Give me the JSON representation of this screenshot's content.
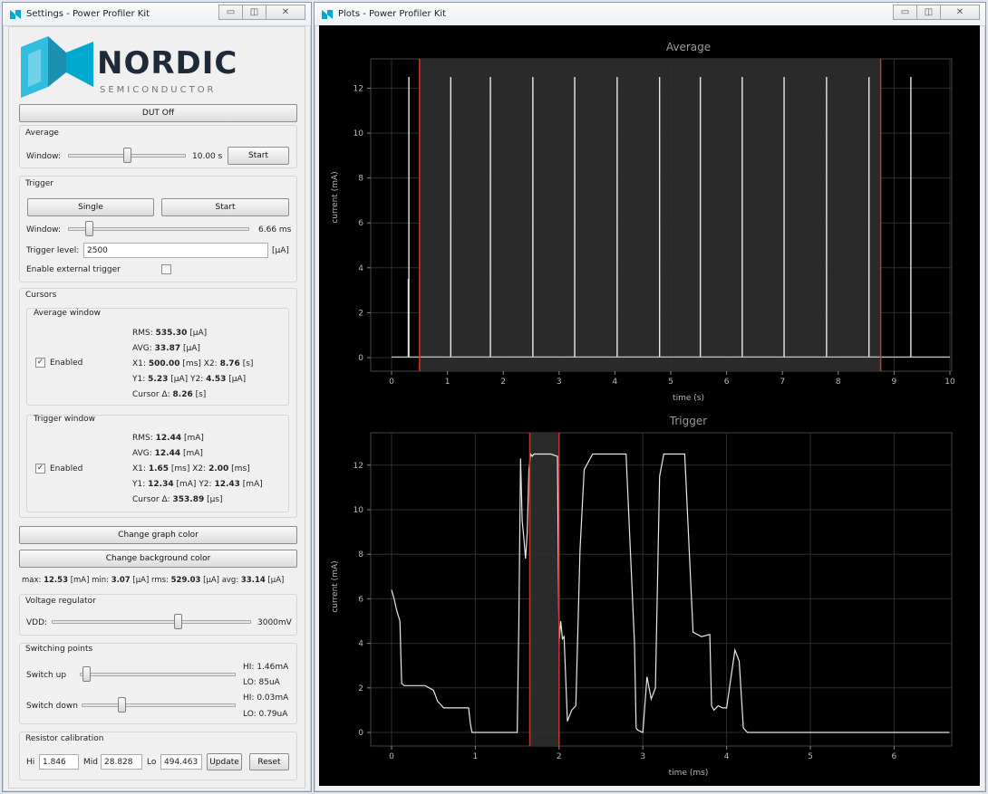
{
  "settings_window": {
    "title": "Settings - Power Profiler Kit",
    "logo": {
      "brand": "NORDIC",
      "sub": "SEMICONDUCTOR"
    },
    "dut_off_label": "DUT Off",
    "average": {
      "title": "Average",
      "window_label": "Window:",
      "window_value": "10.00 s",
      "slider_fraction": 0.5,
      "start_label": "Start"
    },
    "trigger": {
      "title": "Trigger",
      "single_label": "Single",
      "start_label": "Start",
      "window_label": "Window:",
      "window_value": "6.66 ms",
      "slider_fraction": 0.1,
      "level_label": "Trigger level:",
      "level_value": "2500",
      "level_unit": "[µA]",
      "external_label": "Enable external trigger",
      "external_checked": false
    },
    "cursors": {
      "title": "Cursors",
      "average_window": {
        "title": "Average window",
        "enabled_label": "Enabled",
        "enabled": true,
        "rms_label": "RMS:",
        "rms_value": "535.30",
        "rms_unit": "[µA]",
        "avg_label": "AVG:",
        "avg_value": "33.87",
        "avg_unit": "[µA]",
        "x1_label": "X1:",
        "x1_value": "500.00",
        "x1_unit": "[ms]",
        "x2_label": "X2:",
        "x2_value": "8.76",
        "x2_unit": "[s]",
        "y1_label": "Y1:",
        "y1_value": "5.23",
        "y1_unit": "[µA]",
        "y2_label": "Y2:",
        "y2_value": "4.53",
        "y2_unit": "[µA]",
        "delta_label": "Cursor Δ:",
        "delta_value": "8.26",
        "delta_unit": "[s]"
      },
      "trigger_window": {
        "title": "Trigger window",
        "enabled_label": "Enabled",
        "enabled": true,
        "rms_label": "RMS:",
        "rms_value": "12.44",
        "rms_unit": "[mA]",
        "avg_label": "AVG:",
        "avg_value": "12.44",
        "avg_unit": "[mA]",
        "x1_label": "X1:",
        "x1_value": "1.65",
        "x1_unit": "[ms]",
        "x2_label": "X2:",
        "x2_value": "2.00",
        "x2_unit": "[ms]",
        "y1_label": "Y1:",
        "y1_value": "12.34",
        "y1_unit": "[mA]",
        "y2_label": "Y2:",
        "y2_value": "12.43",
        "y2_unit": "[mA]",
        "delta_label": "Cursor Δ:",
        "delta_value": "353.89",
        "delta_unit": "[µs]"
      }
    },
    "change_graph_color_label": "Change graph color",
    "change_background_color_label": "Change background color",
    "status": {
      "max_label": "max:",
      "max_value": "12.53",
      "max_unit": "[mA]",
      "min_label": "min:",
      "min_value": "3.07",
      "min_unit": "[µA]",
      "rms_label": "rms:",
      "rms_value": "529.03",
      "rms_unit": "[µA]",
      "avg_label": "avg:",
      "avg_value": "33.14",
      "avg_unit": "[µA]"
    },
    "voltage_regulator": {
      "title": "Voltage regulator",
      "vdd_label": "VDD:",
      "vdd_value": "3000mV",
      "slider_fraction": 0.64
    },
    "switching_points": {
      "title": "Switching points",
      "switch_up_label": "Switch up",
      "switch_up_fraction": 0.02,
      "hi_up": "HI: 1.46mA",
      "lo_up": "LO: 85uA",
      "switch_down_label": "Switch down",
      "switch_down_fraction": 0.25,
      "hi_down": "HI: 0.03mA",
      "lo_down": "LO: 0.79uA"
    },
    "resistor_calibration": {
      "title": "Resistor calibration",
      "hi_label": "Hi",
      "hi_value": "1.846",
      "mid_label": "Mid",
      "mid_value": "28.828",
      "lo_label": "Lo",
      "lo_value": "494.463",
      "update_label": "Update",
      "reset_label": "Reset"
    }
  },
  "plots_window": {
    "title": "Plots - Power Profiler Kit"
  },
  "colors": {
    "trace": "#e8e8e8",
    "cursor": "#c0392b",
    "plot_bg": "#000000",
    "selection": "#2a2a2a",
    "brand_blue": "#00a9ce",
    "brand_dark": "#1e2a3a"
  },
  "chart_data": [
    {
      "type": "line",
      "title": "Average",
      "xlabel": "time (s)",
      "ylabel": "current (mA)",
      "xlim": [
        0,
        10
      ],
      "ylim": [
        0,
        12
      ],
      "xticks": [
        "0",
        "1",
        "2",
        "3",
        "4",
        "5",
        "6",
        "7",
        "8",
        "9",
        "10"
      ],
      "yticks": [
        "0",
        "2",
        "4",
        "6",
        "8",
        "10",
        "12"
      ],
      "grid": true,
      "cursors": [
        0.5,
        8.76
      ],
      "baseline": 0.03,
      "spikes": [
        {
          "x": 0.3,
          "y": 3.5
        },
        {
          "x": 0.31,
          "y": 12.5
        },
        {
          "x": 1.06,
          "y": 12.5
        },
        {
          "x": 1.77,
          "y": 12.5
        },
        {
          "x": 2.53,
          "y": 12.5
        },
        {
          "x": 3.28,
          "y": 12.5
        },
        {
          "x": 4.04,
          "y": 12.5
        },
        {
          "x": 4.8,
          "y": 12.5
        },
        {
          "x": 5.53,
          "y": 12.5
        },
        {
          "x": 6.28,
          "y": 12.5
        },
        {
          "x": 7.03,
          "y": 12.5
        },
        {
          "x": 7.79,
          "y": 12.5
        },
        {
          "x": 8.55,
          "y": 12.5
        },
        {
          "x": 9.3,
          "y": 12.5
        }
      ]
    },
    {
      "type": "line",
      "title": "Trigger",
      "xlabel": "time (ms)",
      "ylabel": "current (mA)",
      "xlim": [
        0,
        6.66
      ],
      "ylim": [
        0,
        12
      ],
      "xticks": [
        "0",
        "1",
        "2",
        "3",
        "4",
        "5",
        "6"
      ],
      "yticks": [
        "0",
        "2",
        "4",
        "6",
        "8",
        "10",
        "12"
      ],
      "grid": true,
      "cursors": [
        1.65,
        2.0
      ],
      "x": [
        0,
        0.03,
        0.06,
        0.1,
        0.12,
        0.15,
        0.4,
        0.5,
        0.55,
        0.6,
        0.62,
        0.92,
        0.94,
        0.96,
        1.0,
        1.2,
        1.4,
        1.5,
        1.52,
        1.54,
        1.56,
        1.58,
        1.6,
        1.62,
        1.64,
        1.66,
        1.68,
        1.7,
        1.8,
        1.9,
        1.98,
        2.0,
        2.02,
        2.04,
        2.06,
        2.1,
        2.15,
        2.2,
        2.25,
        2.3,
        2.4,
        2.5,
        2.6,
        2.7,
        2.8,
        2.9,
        2.92,
        2.94,
        3.0,
        3.05,
        3.1,
        3.15,
        3.2,
        3.25,
        3.3,
        3.4,
        3.5,
        3.6,
        3.7,
        3.8,
        3.82,
        3.85,
        3.9,
        3.95,
        4.0,
        4.1,
        4.15,
        4.2,
        4.25,
        4.27,
        4.3,
        5.0,
        6.66
      ],
      "y": [
        6.4,
        6.0,
        5.5,
        5.0,
        2.2,
        2.1,
        2.1,
        1.9,
        1.4,
        1.2,
        1.1,
        1.1,
        0.4,
        0.0,
        0.0,
        0.0,
        0.0,
        0.0,
        4.8,
        12.3,
        9.5,
        8.7,
        7.8,
        9.0,
        11.8,
        12.5,
        12.4,
        12.5,
        12.5,
        12.5,
        12.4,
        4.0,
        5.0,
        4.2,
        4.3,
        0.5,
        1.0,
        1.2,
        8.2,
        11.8,
        12.5,
        12.5,
        12.5,
        12.5,
        12.5,
        4.0,
        0.2,
        0.1,
        0.0,
        2.5,
        1.5,
        2.0,
        11.5,
        12.5,
        12.5,
        12.5,
        12.5,
        4.5,
        4.3,
        4.4,
        1.2,
        1.0,
        1.2,
        1.1,
        1.1,
        3.7,
        3.2,
        0.2,
        0.0,
        0.0,
        0.0,
        0.0,
        0.0
      ]
    }
  ]
}
